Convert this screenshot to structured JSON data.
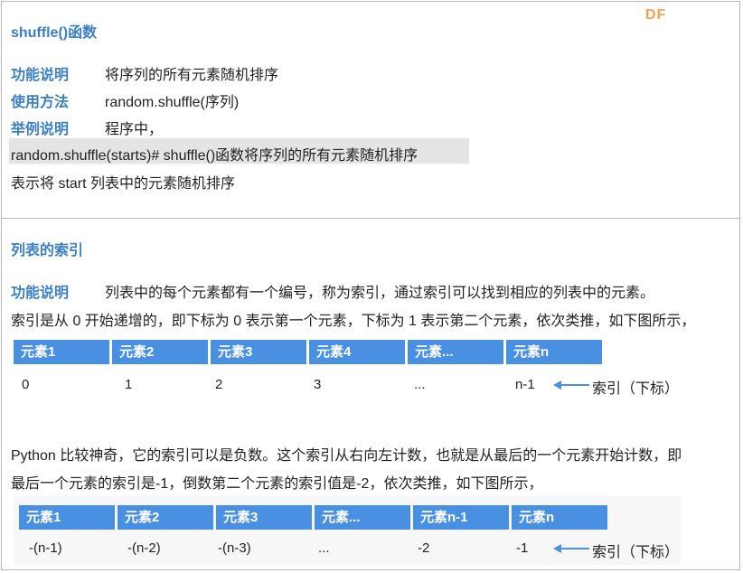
{
  "watermark": "DF",
  "section1": {
    "title": "shuffle()函数",
    "rows": [
      {
        "label": "功能说明",
        "text": "将序列的所有元素随机排序"
      },
      {
        "label": "使用方法",
        "text": "random.shuffle(序列)"
      },
      {
        "label": "举例说明",
        "text": "程序中，"
      }
    ],
    "code": "random.shuffle(starts)# shuffle()函数将序列的所有元素随机排序",
    "note": "表示将 start 列表中的元素随机排序"
  },
  "section2": {
    "title": "列表的索引",
    "func_label": "功能说明",
    "func_text": "列表中的每个元素都有一个编号，称为索引，通过索引可以找到相应的列表中的元素。",
    "para1": "索引是从 0 开始递增的，即下标为 0 表示第一个元素，下标为 1 表示第二个元素，依次类推，如下图所示，",
    "table1": {
      "headers": [
        "元素1",
        "元素2",
        "元素3",
        "元素4",
        "元素...",
        "元素n"
      ],
      "values": [
        "0",
        "1",
        "2",
        "3",
        "...",
        "n-1"
      ],
      "index_label": "索引（下标）"
    },
    "para2_line1": "Python 比较神奇，它的索引可以是负数。这个索引从右向左计数，也就是从最后的一个元素开始计数，即",
    "para2_line2": "最后一个元素的索引是-1，倒数第二个元素的索引值是-2，依次类推，如下图所示，",
    "table2": {
      "headers": [
        "元素1",
        "元素2",
        "元素3",
        "元素...",
        "元素n-1",
        "元素n"
      ],
      "values": [
        "-(n-1)",
        "-(n-2)",
        "-(n-3)",
        "...",
        "-2",
        "-1"
      ],
      "index_label": "索引（下标）"
    }
  }
}
